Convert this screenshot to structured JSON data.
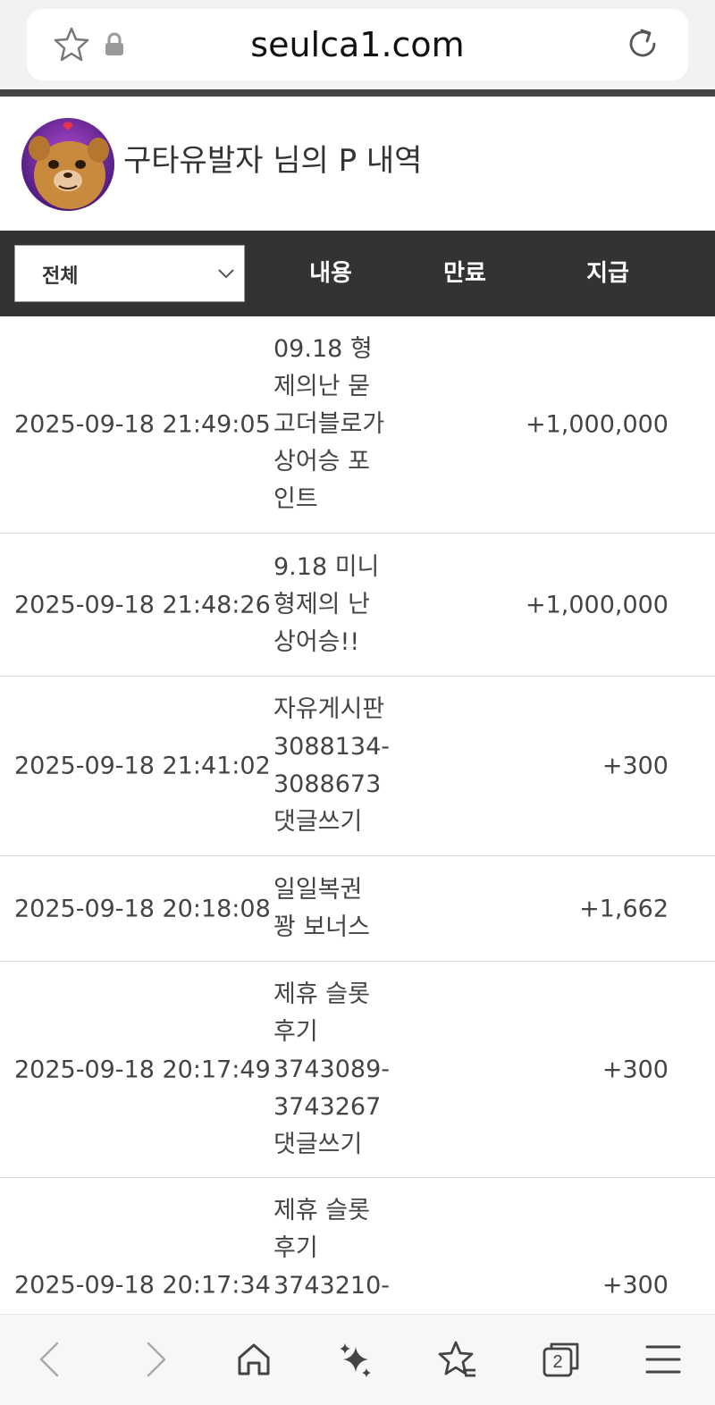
{
  "browser": {
    "url": "seulca1.com",
    "tab_count": "2"
  },
  "profile": {
    "title": "구타유발자 님의 P 내역"
  },
  "table": {
    "filter_value": "전체",
    "headers": {
      "content": "내용",
      "expire": "만료",
      "pay": "지급"
    },
    "rows": [
      {
        "date": "2025-09-18 21:49:05",
        "content": [
          "09.18 형",
          "제의난 묻",
          "고더블로가",
          "상어승 포",
          "인트"
        ],
        "expire": "",
        "amount": "+1,000,000"
      },
      {
        "date": "2025-09-18 21:48:26",
        "content": [
          "9.18 미니",
          "형제의 난",
          "상어승!!"
        ],
        "expire": "",
        "amount": "+1,000,000"
      },
      {
        "date": "2025-09-18 21:41:02",
        "content": [
          "자유게시판",
          "3088134-",
          "3088673",
          "댓글쓰기"
        ],
        "expire": "",
        "amount": "+300"
      },
      {
        "date": "2025-09-18 20:18:08",
        "content": [
          "일일복권",
          "꽝 보너스"
        ],
        "expire": "",
        "amount": "+1,662"
      },
      {
        "date": "2025-09-18 20:17:49",
        "content": [
          "제휴 슬롯",
          "후기",
          "3743089-",
          "3743267",
          "댓글쓰기"
        ],
        "expire": "",
        "amount": "+300"
      },
      {
        "date": "2025-09-18 20:17:34",
        "content": [
          "제휴 슬롯",
          "후기",
          "3743210-"
        ],
        "expire": "",
        "amount": "+300"
      }
    ]
  },
  "colors": {
    "header_bg": "#333333",
    "divider": "#d8d8d8",
    "top_bar_bg": "#f2f2f2"
  },
  "icons": {
    "bookmark": "star-icon",
    "secure": "lock-icon",
    "reload": "reload-icon",
    "back": "back-icon",
    "forward": "forward-icon",
    "home": "home-icon",
    "ai": "sparkle-icon",
    "favorites": "favorites-icon",
    "tabs": "tabs-icon",
    "menu": "menu-icon"
  }
}
